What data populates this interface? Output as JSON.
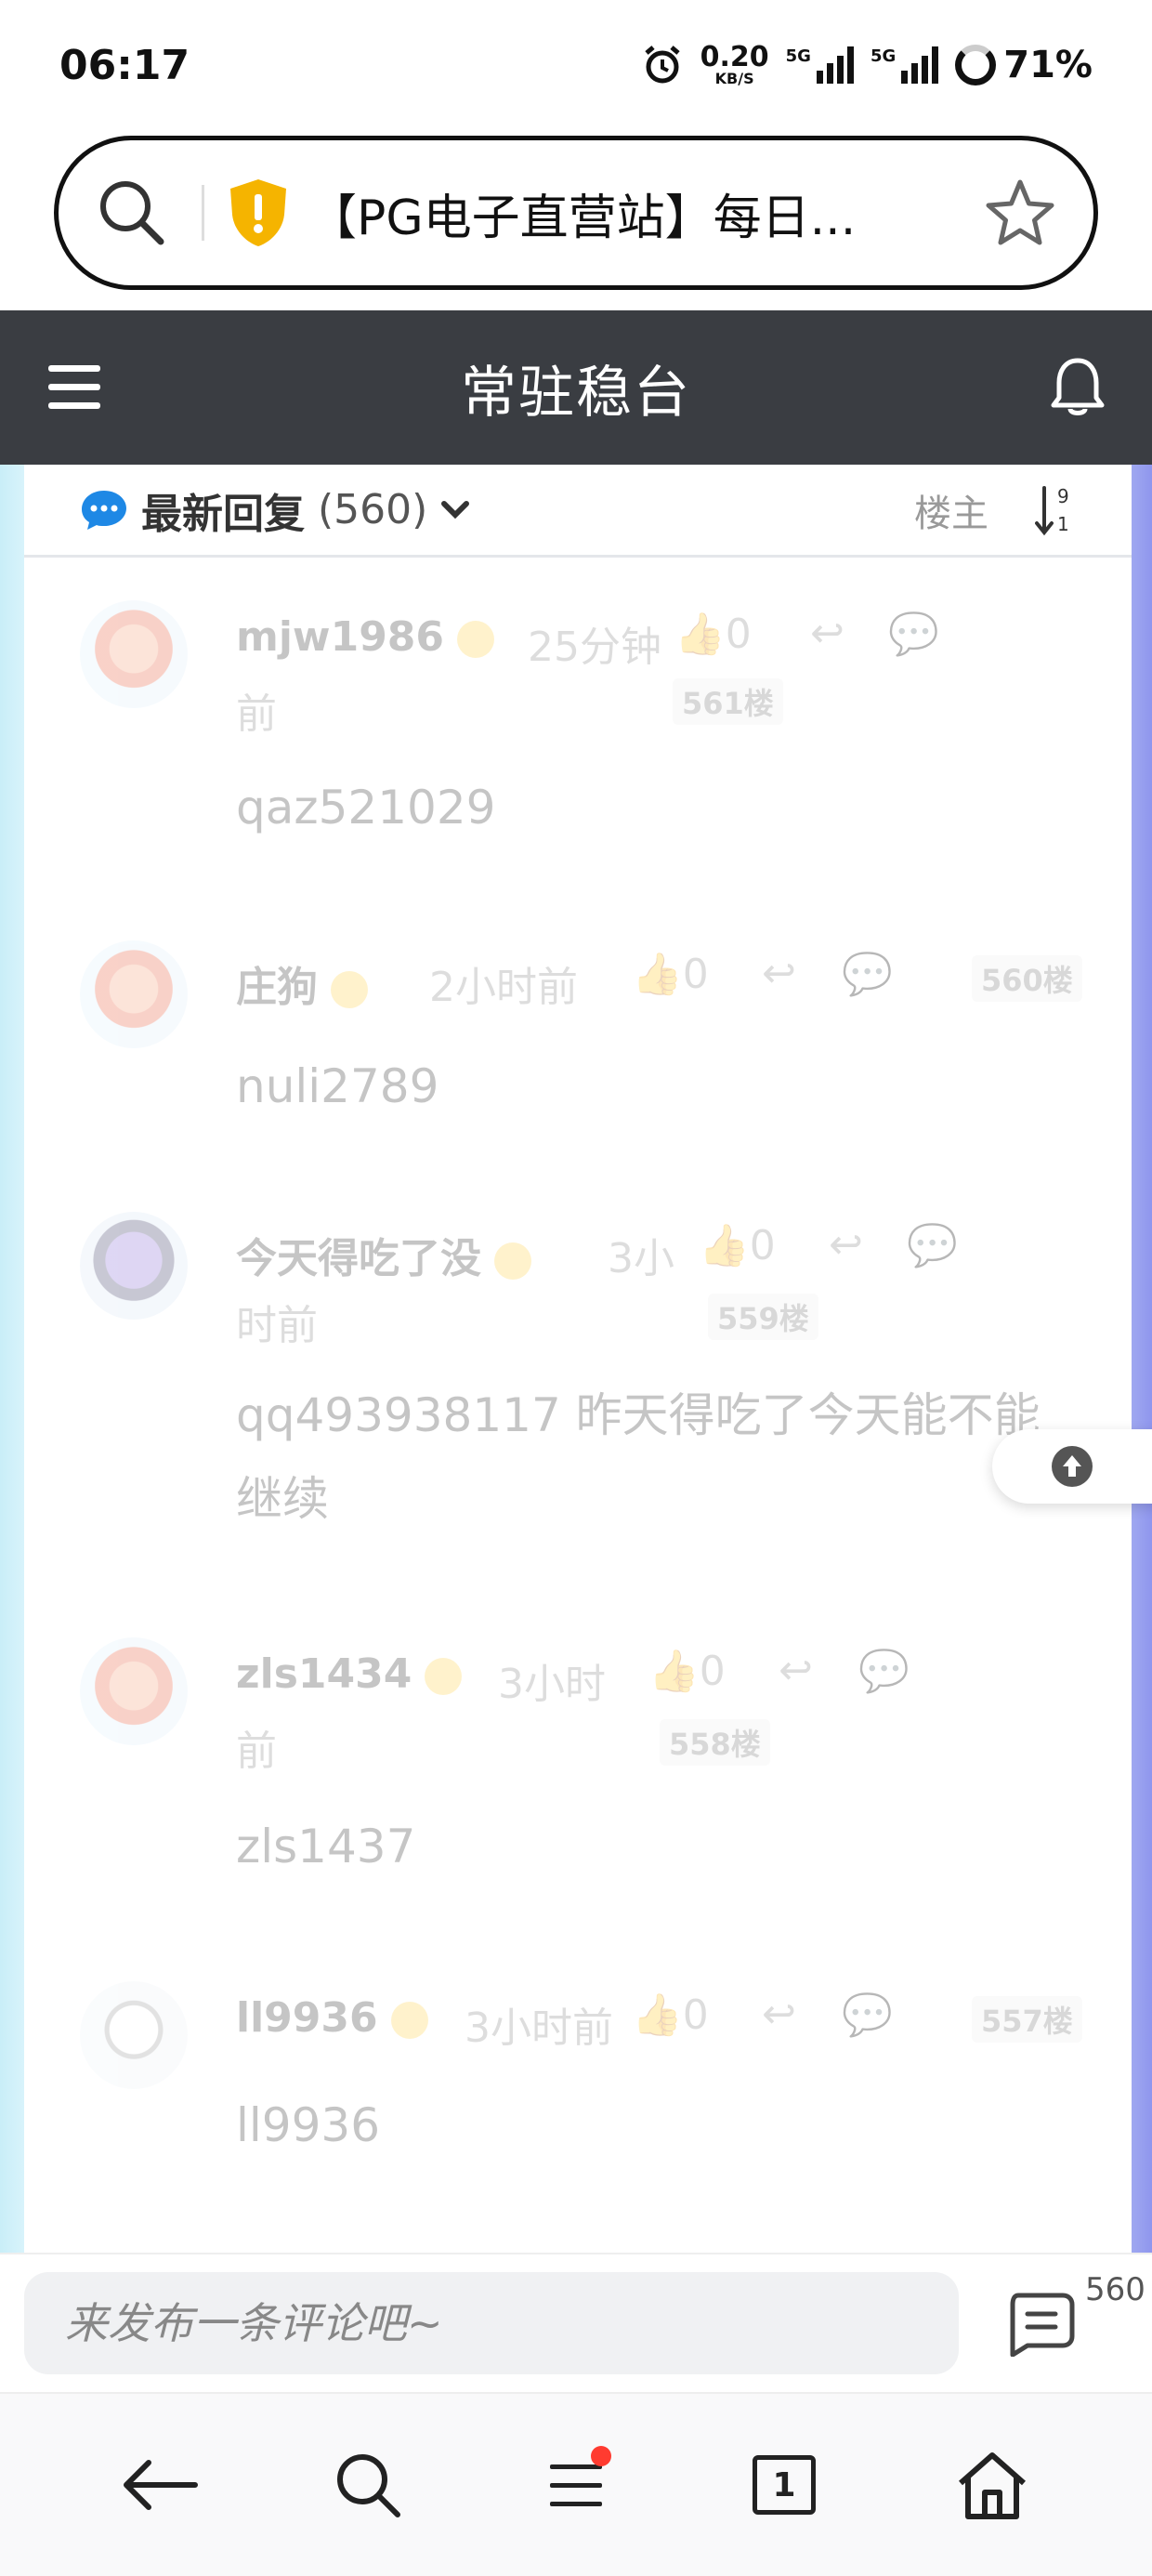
{
  "status_bar": {
    "time": "06:17",
    "net_speed": "0.20",
    "net_unit": "KB/S",
    "signal_1": "5G",
    "signal_2": "5G",
    "battery": "71%"
  },
  "url_bar": {
    "title": "【PG电子直营站】每日..."
  },
  "header": {
    "title": "常驻稳台"
  },
  "replies": {
    "label": "最新回复",
    "count": "(560)",
    "op_filter": "楼主"
  },
  "comments": [
    {
      "name": "mjw1986",
      "time_a": "25分钟",
      "time_b": "前",
      "likes": "0",
      "floor": "561楼",
      "body": "qaz521029"
    },
    {
      "name": "庄狗",
      "time_a": "2小时前",
      "time_b": "",
      "likes": "0",
      "floor": "560楼",
      "body": "nuli2789"
    },
    {
      "name": "今天得吃了没",
      "time_a": "3小",
      "time_b": "时前",
      "likes": "0",
      "floor": "559楼",
      "body": "qq493938117 昨天得吃了今天能不能继续"
    },
    {
      "name": "zls1434",
      "time_a": "3小时",
      "time_b": "前",
      "likes": "0",
      "floor": "558楼",
      "body": "zls1437"
    },
    {
      "name": "ll9936",
      "time_a": "3小时前",
      "time_b": "",
      "likes": "0",
      "floor": "557楼",
      "body": "ll9936"
    }
  ],
  "input": {
    "placeholder": "来发布一条评论吧~",
    "comment_count": "560"
  },
  "bottom_nav": {
    "tab_count": "1"
  },
  "colors": {
    "header_bg": "#3a3d42",
    "accent_blue": "#1e88e5",
    "shield_yellow": "#f5b400",
    "notify_red": "#ff3b30"
  }
}
